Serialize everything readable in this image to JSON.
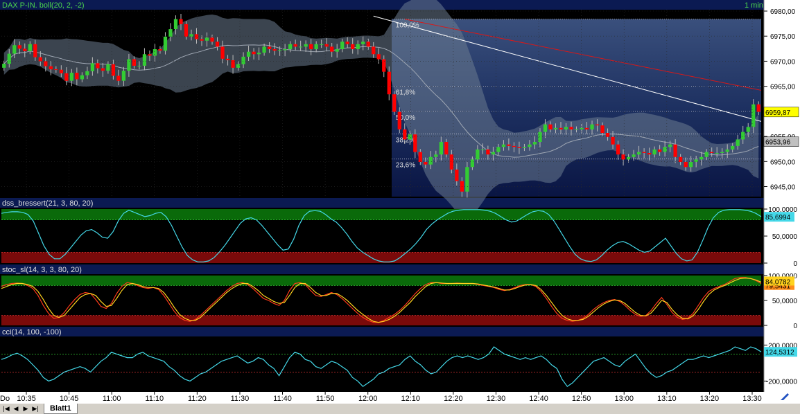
{
  "window": {
    "title": "DAX P-IN. boll(20, 2, -2)",
    "interval": "1 min",
    "sheet_tab": "Blatt1",
    "axis_left_label": "Do"
  },
  "colors": {
    "background": "#000000",
    "panel_bar": "#0b1a52",
    "axis_bg": "#ffffff",
    "up_candle": "#33cc33",
    "down_candle": "#ff0000",
    "bollinger_fill": "#6b7b8f",
    "fib_zone_top": "#39507e",
    "fib_zone_bottom": "#0c1a4a",
    "trend_white": "#ffffff",
    "trend_red": "#d81818",
    "osc_line": "#44d8e8",
    "stoch_fast": "#ffd21e",
    "stoch_slow": "#ff3a1a",
    "overbought_band": "#0a6a0a",
    "oversold_band": "#7a0a0a"
  },
  "chart_data": [
    {
      "type": "candlestick",
      "title": "DAX P-IN. boll(20, 2, -2)",
      "time_labels": [
        "10:35",
        "10:45",
        "11:00",
        "11:10",
        "11:20",
        "11:30",
        "11:40",
        "11:50",
        "12:00",
        "12:10",
        "12:20",
        "12:30",
        "12:40",
        "12:50",
        "13:00",
        "13:10",
        "13:20",
        "13:30"
      ],
      "y_ticks": [
        "6980,00",
        "6975,00",
        "6970,00",
        "6965,00",
        "6960,00",
        "6955,00",
        "6950,00",
        "6945,00"
      ],
      "ylim": [
        6943,
        6980
      ],
      "closes": [
        6969.5,
        6971.5,
        6973.2,
        6972.5,
        6972.0,
        6973.4,
        6970.8,
        6970.0,
        6969.0,
        6968.4,
        6968.3,
        6967.6,
        6966.1,
        6967.7,
        6966.4,
        6967.2,
        6968.0,
        6969.6,
        6968.6,
        6968.1,
        6969.4,
        6967.1,
        6966.1,
        6968.1,
        6970.4,
        6969.1,
        6969.1,
        6971.4,
        6971.1,
        6972.4,
        6972.1,
        6974.9,
        6976.4,
        6978.4,
        6977.4,
        6974.9,
        6975.4,
        6974.4,
        6974.1,
        6974.7,
        6973.9,
        6972.9,
        6970.5,
        6970.2,
        6968.7,
        6969.4,
        6970.9,
        6971.9,
        6971.4,
        6971.7,
        6972.9,
        6972.4,
        6972.1,
        6972.2,
        6972.4,
        6973.4,
        6972.9,
        6972.9,
        6973.4,
        6972.4,
        6973.4,
        6973.4,
        6972.9,
        6971.9,
        6972.4,
        6973.9,
        6973.4,
        6972.4,
        6973.4,
        6973.9,
        6972.9,
        6971.4,
        6970.4,
        6967.9,
        6963.4,
        6959.9,
        6956.4,
        6954.4,
        6955.4,
        6951.9,
        6949.9,
        6949.4,
        6950.9,
        6951.4,
        6953.9,
        6951.4,
        6948.4,
        6946.1,
        6944.0,
        6948.9,
        6950.4,
        6952.4,
        6952.4,
        6951.4,
        6951.9,
        6952.9,
        6953.4,
        6953.1,
        6952.9,
        6952.7,
        6952.9,
        6953.4,
        6953.9,
        6955.9,
        6957.4,
        6956.4,
        6956.7,
        6956.4,
        6956.9,
        6956.4,
        6956.4,
        6956.7,
        6956.4,
        6957.4,
        6957.2,
        6955.7,
        6954.9,
        6953.4,
        6951.4,
        6950.4,
        6950.9,
        6951.4,
        6951.9,
        6951.7,
        6951.4,
        6952.4,
        6951.9,
        6952.9,
        6953.4,
        6950.9,
        6949.9,
        6948.9,
        6949.9,
        6950.4,
        6950.9,
        6951.9,
        6951.7,
        6951.7,
        6951.9,
        6952.4,
        6953.1,
        6954.4,
        6955.9,
        6956.9,
        6961.4,
        6959.9
      ],
      "last_price": "6959,87",
      "band_price": "6953,96",
      "fibonacci": [
        {
          "label": "100,0%",
          "price": 6978.4
        },
        {
          "label": "61,8%",
          "price": 6965.0
        },
        {
          "label": "50,0%",
          "price": 6960.0
        },
        {
          "label": "38,2%",
          "price": 6955.5
        },
        {
          "label": "23,6%",
          "price": 6950.5
        }
      ]
    },
    {
      "type": "line",
      "title": "dss_bressert(21, 3, 80, 20)",
      "y_ticks": [
        "100,0000",
        "50,0000",
        "0"
      ],
      "ylim": [
        0,
        100
      ],
      "levels": [
        80,
        20
      ],
      "last_value": "85,6994",
      "series": [
        {
          "values": [
            92,
            94,
            95,
            95,
            94,
            90,
            78,
            55,
            32,
            16,
            8,
            8,
            16,
            28,
            40,
            52,
            60,
            62,
            56,
            48,
            46,
            58,
            78,
            92,
            98,
            94,
            90,
            86,
            88,
            92,
            94,
            86,
            70,
            50,
            30,
            14,
            6,
            2,
            2,
            4,
            10,
            20,
            32,
            46,
            60,
            74,
            82,
            84,
            80,
            70,
            58,
            46,
            34,
            24,
            26,
            44,
            70,
            88,
            96,
            97,
            96,
            90,
            82,
            76,
            66,
            54,
            40,
            28,
            20,
            14,
            8,
            4,
            2,
            2,
            4,
            10,
            18,
            26,
            36,
            48,
            62,
            72,
            80,
            86,
            92,
            96,
            98,
            99,
            99,
            99,
            99,
            98,
            96,
            92,
            86,
            80,
            76,
            78,
            84,
            90,
            95,
            97,
            96,
            90,
            78,
            62,
            46,
            30,
            16,
            8,
            4,
            3,
            6,
            14,
            24,
            32,
            38,
            40,
            36,
            30,
            24,
            20,
            22,
            30,
            38,
            46,
            32,
            18,
            8,
            4,
            6,
            20,
            42,
            66,
            84,
            94,
            98,
            99,
            99,
            99,
            98,
            96,
            92,
            86
          ]
        }
      ]
    },
    {
      "type": "line",
      "title": "stoc_sl(14, 3, 3, 80, 20)",
      "y_ticks": [
        "100,0000",
        "50,0000",
        "0"
      ],
      "ylim": [
        0,
        100
      ],
      "levels": [
        80,
        20
      ],
      "last_value": "84,0782",
      "series_labels": [
        "84,0782",
        "79,5431"
      ],
      "series": [
        {
          "values": [
            78,
            82,
            84,
            85,
            84,
            80,
            74,
            60,
            40,
            24,
            14,
            16,
            26,
            40,
            52,
            62,
            66,
            64,
            52,
            38,
            34,
            44,
            64,
            78,
            86,
            84,
            80,
            76,
            74,
            76,
            72,
            60,
            44,
            28,
            16,
            10,
            8,
            12,
            20,
            30,
            40,
            50,
            60,
            70,
            78,
            84,
            86,
            82,
            74,
            64,
            54,
            50,
            44,
            40,
            50,
            70,
            84,
            86,
            82,
            70,
            60,
            58,
            62,
            66,
            62,
            54,
            44,
            34,
            24,
            16,
            10,
            6,
            6,
            10,
            16,
            22,
            30,
            40,
            52,
            64,
            74,
            82,
            86,
            86,
            84,
            84,
            84,
            85,
            84,
            84,
            84,
            82,
            80,
            78,
            76,
            72,
            70,
            72,
            76,
            80,
            82,
            82,
            78,
            68,
            54,
            38,
            24,
            14,
            10,
            8,
            10,
            14,
            22,
            32,
            40,
            46,
            50,
            52,
            48,
            40,
            30,
            22,
            18,
            20,
            30,
            44,
            56,
            42,
            26,
            16,
            12,
            14,
            24,
            40,
            56,
            68,
            74,
            78,
            82,
            88,
            94,
            96,
            96,
            94,
            90,
            84
          ]
        },
        {
          "values": [
            74,
            78,
            82,
            84,
            84,
            82,
            78,
            68,
            52,
            34,
            20,
            16,
            20,
            32,
            44,
            56,
            62,
            64,
            60,
            48,
            38,
            40,
            54,
            70,
            82,
            84,
            82,
            78,
            76,
            76,
            74,
            66,
            52,
            36,
            22,
            14,
            10,
            10,
            16,
            26,
            36,
            46,
            56,
            66,
            74,
            80,
            84,
            84,
            78,
            70,
            60,
            54,
            48,
            44,
            46,
            60,
            76,
            84,
            84,
            76,
            66,
            60,
            60,
            64,
            64,
            58,
            50,
            40,
            30,
            22,
            14,
            8,
            6,
            8,
            12,
            18,
            26,
            36,
            46,
            58,
            68,
            78,
            84,
            86,
            85,
            84,
            84,
            84,
            84,
            84,
            84,
            83,
            81,
            79,
            77,
            74,
            71,
            71,
            74,
            78,
            81,
            82,
            80,
            72,
            60,
            46,
            32,
            20,
            13,
            10,
            10,
            12,
            18,
            27,
            36,
            43,
            48,
            51,
            50,
            44,
            35,
            26,
            20,
            19,
            25,
            37,
            50,
            46,
            32,
            21,
            14,
            13,
            19,
            32,
            48,
            62,
            71,
            76,
            80,
            85,
            90,
            94,
            95,
            94,
            91,
            87
          ]
        }
      ]
    },
    {
      "type": "line",
      "title": "cci(14, 100, -100)",
      "y_ticks": [
        "200,0000",
        "-200,0000"
      ],
      "ylim": [
        -320,
        280
      ],
      "levels": [
        100,
        -100
      ],
      "last_value": "124,5312",
      "series": [
        {
          "values": [
            40,
            60,
            90,
            110,
            80,
            40,
            -20,
            -80,
            -160,
            -200,
            -180,
            -140,
            -100,
            -80,
            -60,
            -40,
            -60,
            -100,
            -40,
            20,
            60,
            120,
            100,
            80,
            60,
            60,
            100,
            120,
            80,
            60,
            40,
            20,
            -40,
            -80,
            -140,
            -180,
            -200,
            -160,
            -120,
            -100,
            -60,
            -20,
            20,
            40,
            60,
            80,
            40,
            0,
            20,
            60,
            40,
            -20,
            -60,
            -140,
            -40,
            60,
            120,
            100,
            40,
            20,
            -40,
            -60,
            -20,
            20,
            0,
            -40,
            -80,
            -160,
            -200,
            -260,
            -220,
            -180,
            -120,
            -100,
            -60,
            -40,
            -20,
            40,
            80,
            20,
            -20,
            -80,
            -120,
            -100,
            -40,
            20,
            60,
            80,
            60,
            80,
            60,
            40,
            60,
            100,
            180,
            140,
            100,
            80,
            60,
            40,
            60,
            40,
            60,
            80,
            40,
            -20,
            -60,
            -180,
            -260,
            -220,
            -160,
            -100,
            -40,
            20,
            40,
            60,
            20,
            -20,
            -40,
            20,
            60,
            100,
            20,
            -60,
            -120,
            -160,
            -140,
            -100,
            -80,
            -40,
            0,
            40,
            40,
            60,
            80,
            60,
            80,
            100,
            120,
            140,
            180,
            160,
            140,
            180,
            160,
            124
          ]
        }
      ]
    }
  ]
}
